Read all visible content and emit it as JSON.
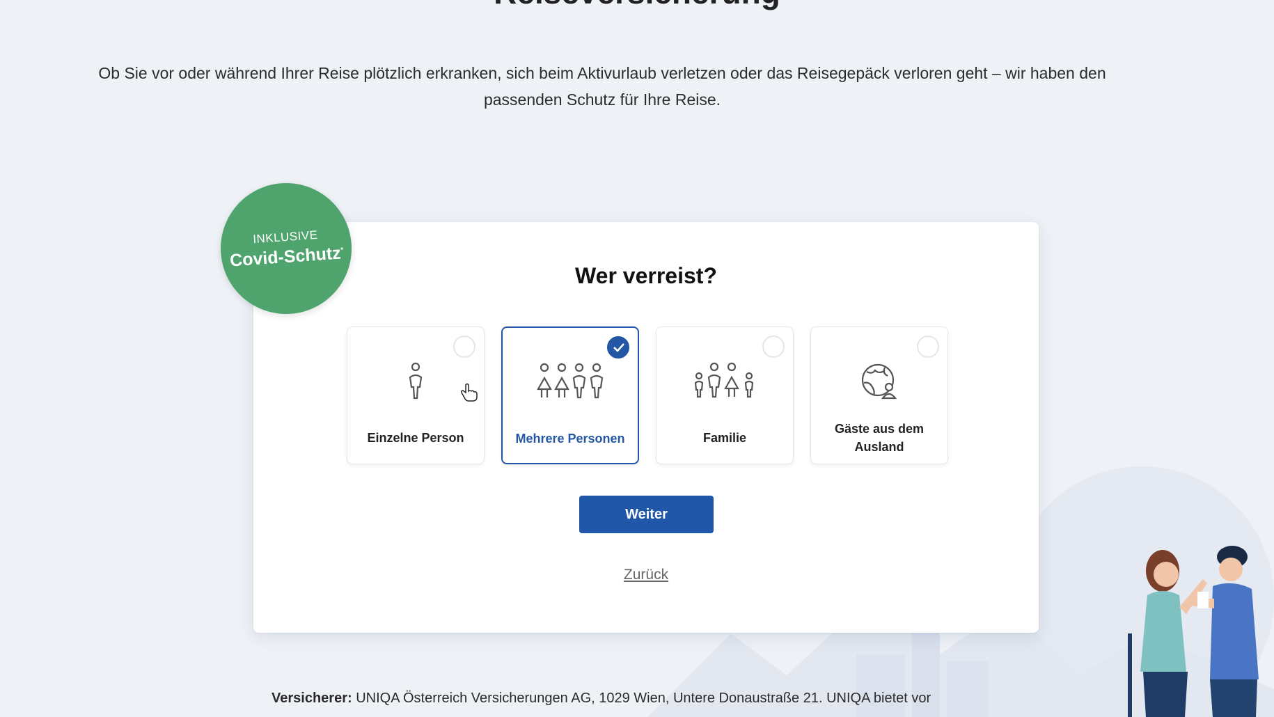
{
  "page": {
    "title": "Reiseversicherung",
    "intro": "Ob Sie vor oder während Ihrer Reise plötzlich erkranken, sich beim Aktivurlaub verletzen oder das Reisegepäck verloren geht – wir haben den passenden Schutz für Ihre Reise."
  },
  "badge": {
    "line1": "INKLUSIVE",
    "line2": "Covid-Schutz",
    "mark": "*"
  },
  "wizard": {
    "question": "Wer verreist?",
    "options": [
      {
        "label": "Einzelne Person",
        "icon": "single-person-icon",
        "selected": false
      },
      {
        "label": "Mehrere Personen",
        "icon": "multiple-persons-icon",
        "selected": true
      },
      {
        "label": "Familie",
        "icon": "family-icon",
        "selected": false
      },
      {
        "label": "Gäste aus dem Ausland",
        "icon": "globe-guest-icon",
        "selected": false
      }
    ],
    "next_label": "Weiter",
    "back_label": "Zurück"
  },
  "footer": {
    "label": "Versicherer:",
    "text": "UNIQA Österreich Versicherungen AG, 1029 Wien, Untere Donaustraße 21. UNIQA bietet vor"
  },
  "colors": {
    "accent": "#2057a8",
    "badge": "#4fa46d",
    "background": "#eef1f6"
  }
}
